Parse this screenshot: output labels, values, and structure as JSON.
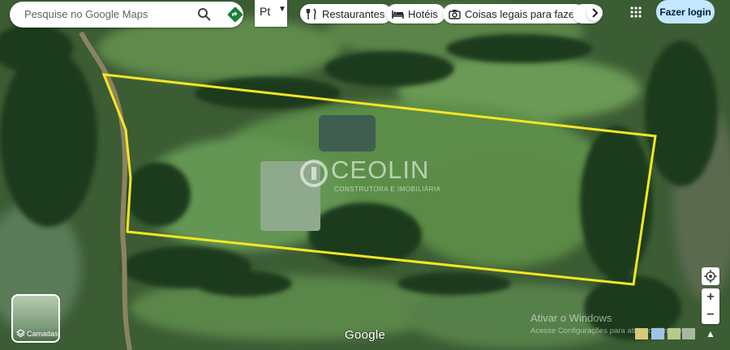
{
  "search": {
    "placeholder": "Pesquise no Google Maps",
    "search_icon": "search-icon",
    "directions_icon": "directions-icon"
  },
  "language_toggle": {
    "label": "Pt",
    "menu_icon": "chevron-down-icon"
  },
  "chips": [
    {
      "label": "Restaurantes",
      "icon": "fork-knife-icon"
    },
    {
      "label": "Hotéis",
      "icon": "bed-icon"
    },
    {
      "label": "Coisas legais para fazer",
      "icon": "camera-icon"
    }
  ],
  "chips_more_icon": "chevron-right-icon",
  "apps_icon": "apps-grid-icon",
  "login_label": "Fazer login",
  "layers": {
    "label": "Camadas",
    "icon": "layers-icon"
  },
  "brand_watermark": {
    "name": "CEOLIN",
    "subtitle": "CONSTRUTORA E IMOBILIÁRIA"
  },
  "google_logo": "Google",
  "windows_activation": {
    "title": "Ativar o Windows",
    "subtitle": "Acesse Configurações para ativar o Windows."
  },
  "controls": {
    "location_icon": "my-location-icon",
    "zoom_in": "+",
    "zoom_out": "−",
    "expand_icon": "chevron-up-icon"
  },
  "colors": {
    "boundary": "#f6e622",
    "login_bg": "#c2e7ff",
    "directions": "#188038"
  }
}
